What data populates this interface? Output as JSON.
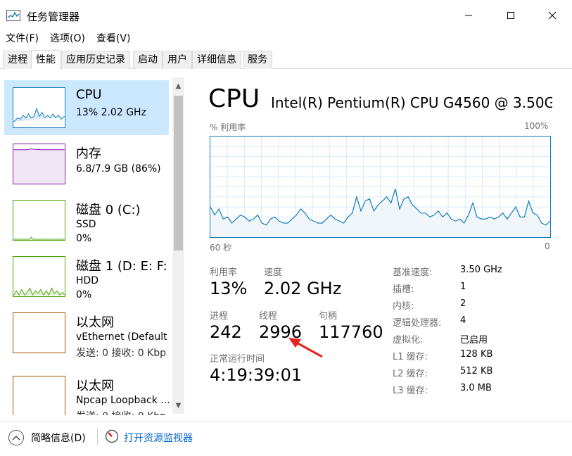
{
  "window": {
    "title": "任务管理器",
    "minimize_icon": "minimize-icon",
    "maximize_icon": "maximize-icon",
    "close_icon": "close-icon"
  },
  "menu": [
    "文件(F)",
    "选项(O)",
    "查看(V)"
  ],
  "tabs": [
    "进程",
    "性能",
    "应用历史记录",
    "启动",
    "用户",
    "详细信息",
    "服务"
  ],
  "active_tab": "性能",
  "sidebar": [
    {
      "title": "CPU",
      "line1": "13%  2.02 GHz",
      "line2": "",
      "color": "#117dbb"
    },
    {
      "title": "内存",
      "line1": "6.8/7.9 GB (86%)",
      "line2": "",
      "color": "#8b12ae"
    },
    {
      "title": "磁盘 0 (C:)",
      "line1": "SSD",
      "line2": "0%",
      "color": "#4da60c"
    },
    {
      "title": "磁盘 1 (D: E: F:",
      "line1": "HDD",
      "line2": "0%",
      "color": "#4da60c"
    },
    {
      "title": "以太网",
      "line1": "vEthernet (Default",
      "line2": "发送: 0 接收: 0 Kbp",
      "color": "#a74f01"
    },
    {
      "title": "以太网",
      "line1": "Npcap Loopback ...",
      "line2": "发送: 0 接收: 0 Kbp",
      "color": "#a74f01"
    }
  ],
  "detail": {
    "title": "CPU",
    "cpu_name": "Intel(R) Pentium(R) CPU G4560 @ 3.50G...",
    "graph_label_left": "% 利用率",
    "graph_label_right": "100%",
    "axis_left": "60 秒",
    "axis_right": "0",
    "graph_color": "#117dbb",
    "util_series": [
      30,
      22,
      28,
      18,
      20,
      14,
      18,
      22,
      20,
      16,
      18,
      22,
      14,
      12,
      18,
      20,
      16,
      14,
      14,
      18,
      22,
      28,
      24,
      18,
      16,
      14,
      14,
      18,
      22,
      18,
      16,
      14,
      20,
      24,
      40,
      26,
      36,
      38,
      26,
      32,
      36,
      40,
      34,
      48,
      28,
      38,
      40,
      32,
      28,
      24,
      24,
      20,
      22,
      26,
      20,
      24,
      18,
      16,
      18,
      14,
      22,
      34,
      20,
      18,
      18,
      20,
      18,
      20,
      24,
      18,
      24,
      30,
      20,
      20,
      36,
      24,
      22,
      14,
      12,
      16
    ]
  },
  "stats": {
    "util_label": "利用率",
    "util_value": "13%",
    "speed_label": "速度",
    "speed_value": "2.02 GHz",
    "proc_label": "进程",
    "proc_value": "242",
    "thread_label": "线程",
    "thread_value": "2996",
    "handle_label": "句柄",
    "handle_value": "117760",
    "uptime_label": "正常运行时间",
    "uptime_value": "4:19:39:01"
  },
  "specs": [
    {
      "label": "基准速度:",
      "value": "3.50 GHz"
    },
    {
      "label": "插槽:",
      "value": "1"
    },
    {
      "label": "内核:",
      "value": "2"
    },
    {
      "label": "逻辑处理器:",
      "value": "4"
    },
    {
      "label": "虚拟化:",
      "value": "已启用"
    },
    {
      "label": "L1 缓存:",
      "value": "128 KB"
    },
    {
      "label": "L2 缓存:",
      "value": "512 KB"
    },
    {
      "label": "L3 缓存:",
      "value": "3.0 MB"
    }
  ],
  "footer": {
    "fewer_details": "简略信息(D)",
    "open_monitor": "打开资源监视器"
  }
}
